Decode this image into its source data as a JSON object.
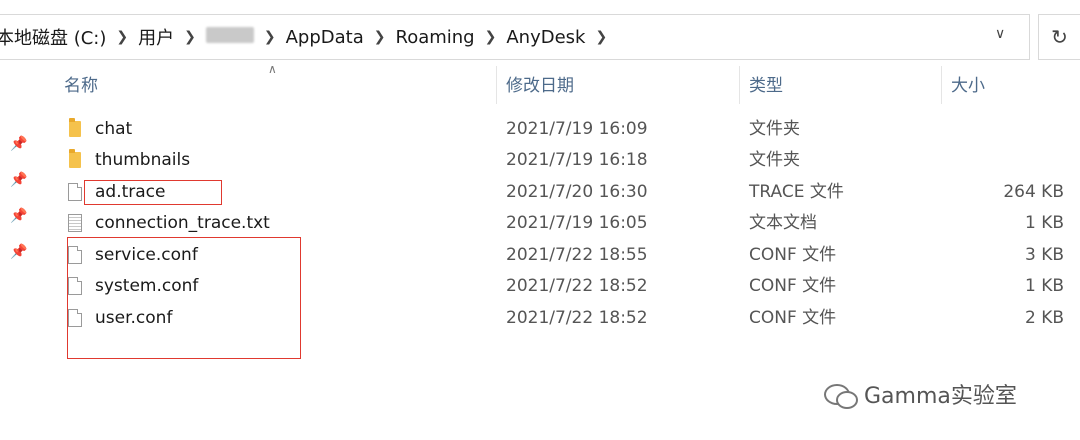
{
  "breadcrumb": {
    "items": [
      "本地磁盘 (C:)",
      "用户",
      "",
      "AppData",
      "Roaming",
      "AnyDesk"
    ]
  },
  "columns": {
    "name": "名称",
    "modified": "修改日期",
    "type": "类型",
    "size": "大小"
  },
  "files": [
    {
      "name": "chat",
      "modified": "2021/7/19 16:09",
      "type": "文件夹",
      "size": "",
      "icon": "folder-icon"
    },
    {
      "name": "thumbnails",
      "modified": "2021/7/19 16:18",
      "type": "文件夹",
      "size": "",
      "icon": "folder-icon"
    },
    {
      "name": "ad.trace",
      "modified": "2021/7/20 16:30",
      "type": "TRACE 文件",
      "size": "264 KB",
      "icon": "file-icon"
    },
    {
      "name": "connection_trace.txt",
      "modified": "2021/7/19 16:05",
      "type": "文本文档",
      "size": "1 KB",
      "icon": "text-file-icon"
    },
    {
      "name": "service.conf",
      "modified": "2021/7/22 18:55",
      "type": "CONF 文件",
      "size": "3 KB",
      "icon": "file-icon"
    },
    {
      "name": "system.conf",
      "modified": "2021/7/22 18:52",
      "type": "CONF 文件",
      "size": "1 KB",
      "icon": "file-icon"
    },
    {
      "name": "user.conf",
      "modified": "2021/7/22 18:52",
      "type": "CONF 文件",
      "size": "2 KB",
      "icon": "file-icon"
    }
  ],
  "watermark": {
    "text": "Gamma实验室"
  },
  "colors": {
    "highlight": "#e0392f",
    "folder": "#f5c24c",
    "header_text": "#4d6a8a"
  }
}
